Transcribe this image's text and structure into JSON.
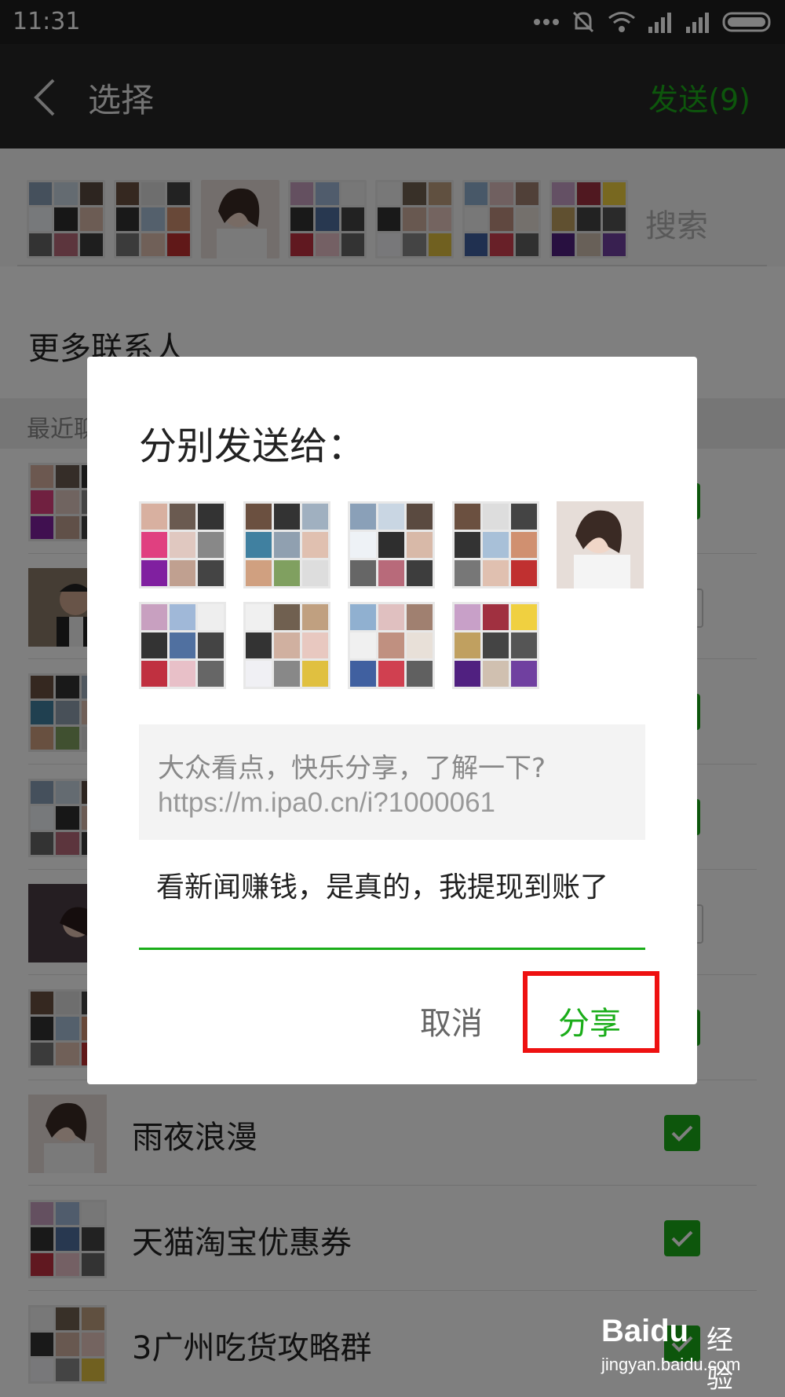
{
  "status_bar": {
    "time": "11:31"
  },
  "nav": {
    "title": "选择",
    "send_label": "发送(9)"
  },
  "selected_strip": {
    "search_placeholder": "搜索"
  },
  "more_contacts": "更多联系人",
  "section_header": "最近聊天",
  "contacts": [
    {
      "name": ""
    },
    {
      "name": ""
    },
    {
      "name": ""
    },
    {
      "name": ""
    },
    {
      "name": ""
    },
    {
      "name": ""
    },
    {
      "name": "雨夜浪漫",
      "checked": true
    },
    {
      "name": "天猫淘宝优惠券",
      "checked": true
    },
    {
      "name": "3广州吃货攻略群",
      "checked": true
    }
  ],
  "dialog": {
    "title": "分别发送给：",
    "article_title": "大众看点，快乐分享，了解一下?",
    "article_url": "https://m.ipa0.cn/i?1000061",
    "message": "看新闻赚钱，是真的，我提现到账了",
    "cancel_label": "取消",
    "share_label": "分享"
  },
  "watermark": {
    "logo": "Baidu",
    "jingyan": "经验",
    "url": "jingyan.baidu.com"
  },
  "colors": {
    "accent_green": "#1aad19",
    "highlight_red": "#ee1111"
  }
}
